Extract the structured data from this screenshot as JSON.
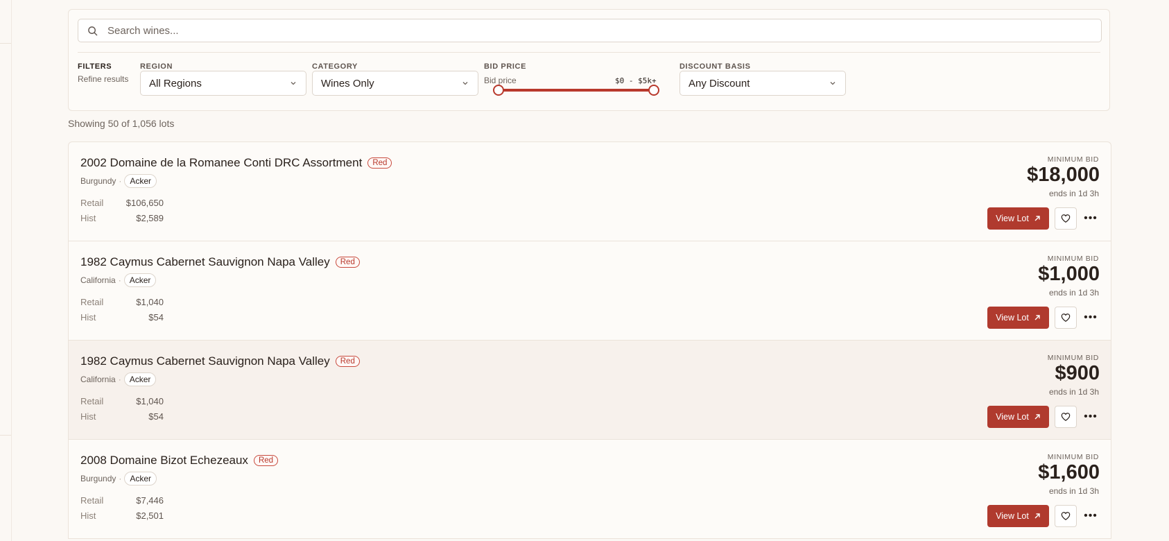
{
  "search": {
    "placeholder": "Search wines..."
  },
  "filters": {
    "title": "FILTERS",
    "subtitle": "Refine results",
    "region": {
      "label": "REGION",
      "value": "All Regions"
    },
    "category": {
      "label": "CATEGORY",
      "value": "Wines Only"
    },
    "bid_price": {
      "label": "BID PRICE",
      "sublabel": "Bid price",
      "range_text": "$0 - $5k+",
      "min_fraction": 0.0,
      "max_fraction": 1.0
    },
    "discount": {
      "label": "DISCOUNT BASIS",
      "value": "Any Discount"
    }
  },
  "results": {
    "showing": "Showing 50 of 1,056 lots"
  },
  "labels": {
    "minimum_bid": "MINIMUM BID",
    "retail": "Retail",
    "hist": "Hist",
    "view_lot": "View Lot"
  },
  "lots": [
    {
      "title": "2002 Domaine de la Romanee Conti DRC Assortment",
      "type": "Red",
      "region": "Burgundy",
      "house": "Acker",
      "retail": "$106,650",
      "hist": "$2,589",
      "min_bid": "$18,000",
      "ends": "ends in 1d 3h"
    },
    {
      "title": "1982 Caymus Cabernet Sauvignon Napa Valley",
      "type": "Red",
      "region": "California",
      "house": "Acker",
      "retail": "$1,040",
      "hist": "$54",
      "min_bid": "$1,000",
      "ends": "ends in 1d 3h"
    },
    {
      "title": "1982 Caymus Cabernet Sauvignon Napa Valley",
      "type": "Red",
      "region": "California",
      "house": "Acker",
      "retail": "$1,040",
      "hist": "$54",
      "min_bid": "$900",
      "ends": "ends in 1d 3h"
    },
    {
      "title": "2008 Domaine Bizot Echezeaux",
      "type": "Red",
      "region": "Burgundy",
      "house": "Acker",
      "retail": "$7,446",
      "hist": "$2,501",
      "min_bid": "$1,600",
      "ends": "ends in 1d 3h"
    }
  ],
  "colors": {
    "accent": "#b03a2e",
    "background": "#fbf8f4"
  }
}
